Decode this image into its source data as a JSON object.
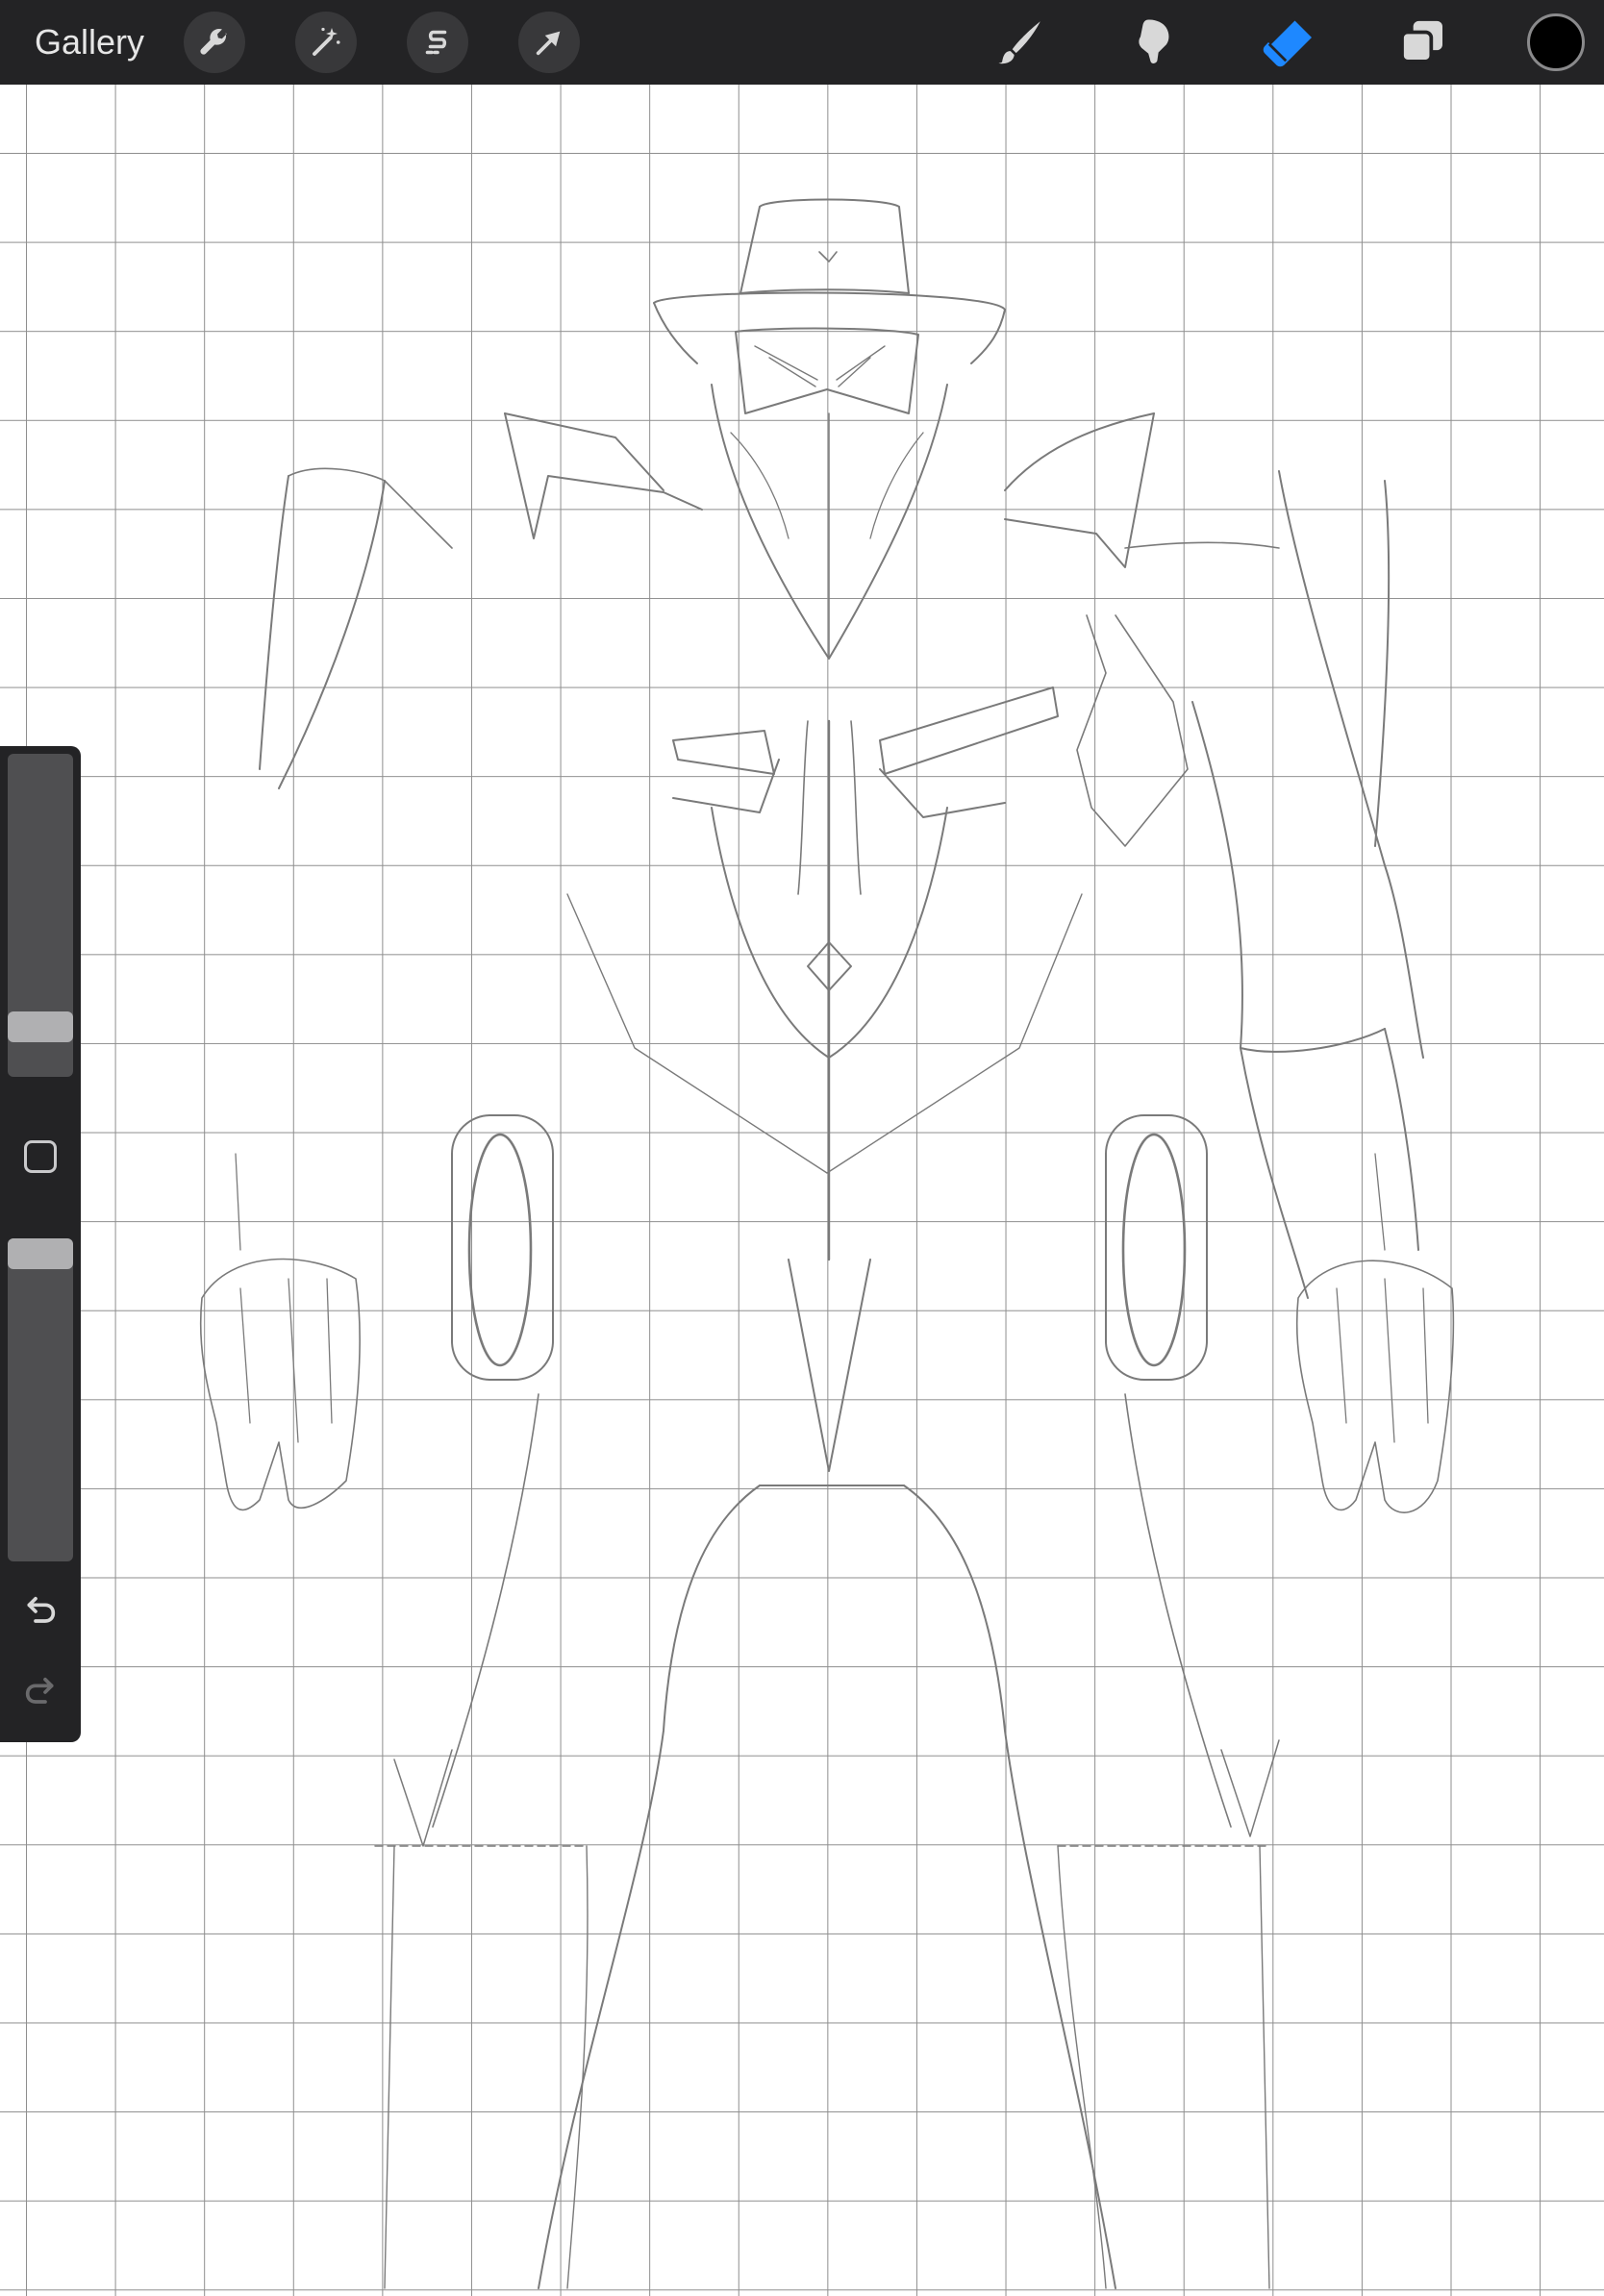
{
  "toolbar": {
    "gallery_label": "Gallery",
    "left_tools": [
      {
        "name": "actions",
        "icon": "wrench-icon"
      },
      {
        "name": "adjustments",
        "icon": "magic-wand-icon"
      },
      {
        "name": "selection",
        "icon": "selection-s-icon"
      },
      {
        "name": "transform",
        "icon": "arrow-cursor-icon"
      }
    ],
    "right_tools": [
      {
        "name": "brush",
        "icon": "brush-icon",
        "active": false
      },
      {
        "name": "smudge",
        "icon": "smudge-finger-icon",
        "active": false
      },
      {
        "name": "eraser",
        "icon": "eraser-icon",
        "active": true
      },
      {
        "name": "layers",
        "icon": "layers-icon",
        "active": false
      }
    ],
    "current_color": "#000000"
  },
  "sidebar": {
    "brush_size": 0.12,
    "opacity": 1.0,
    "modify_icon": "square-icon",
    "undo_icon": "undo-arrow-icon",
    "redo_icon": "redo-arrow-icon"
  },
  "colors": {
    "toolbar_bg": "#232325",
    "accent_active": "#1e88ff",
    "grid_line": "#8e8e8e",
    "sketch_stroke": "#7a7a7a"
  }
}
